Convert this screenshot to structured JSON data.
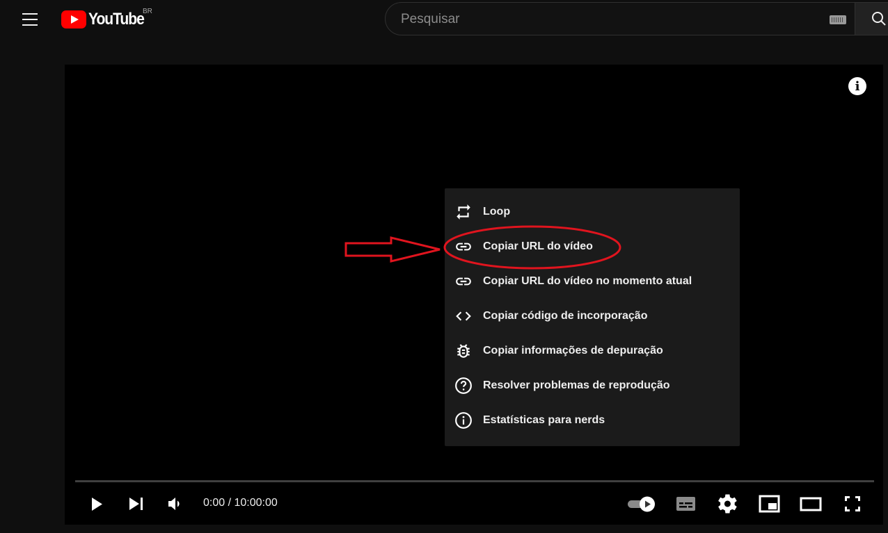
{
  "header": {
    "logo_text": "YouTube",
    "region_code": "BR",
    "search_placeholder": "Pesquisar"
  },
  "player": {
    "info_glyph": "i",
    "time_display": "0:00 / 10:00:00",
    "progress_fraction": 0.0,
    "context_menu": {
      "items": [
        {
          "label": "Loop",
          "icon": "loop-icon"
        },
        {
          "label": "Copiar URL do vídeo",
          "icon": "link-icon"
        },
        {
          "label": "Copiar URL do vídeo no momento atual",
          "icon": "link-icon"
        },
        {
          "label": "Copiar código de incorporação",
          "icon": "code-icon"
        },
        {
          "label": "Copiar informações de depuração",
          "icon": "bug-icon"
        },
        {
          "label": "Resolver problemas de reprodução",
          "icon": "help-icon"
        },
        {
          "label": "Estatísticas para nerds",
          "icon": "info-icon"
        }
      ]
    },
    "controls": [
      "play-icon",
      "next-icon",
      "volume-icon",
      "autoplay-toggle",
      "subtitles-icon",
      "settings-icon",
      "miniplayer-icon",
      "theater-icon",
      "fullscreen-icon"
    ]
  },
  "annotation": {
    "color": "#e0141e"
  }
}
